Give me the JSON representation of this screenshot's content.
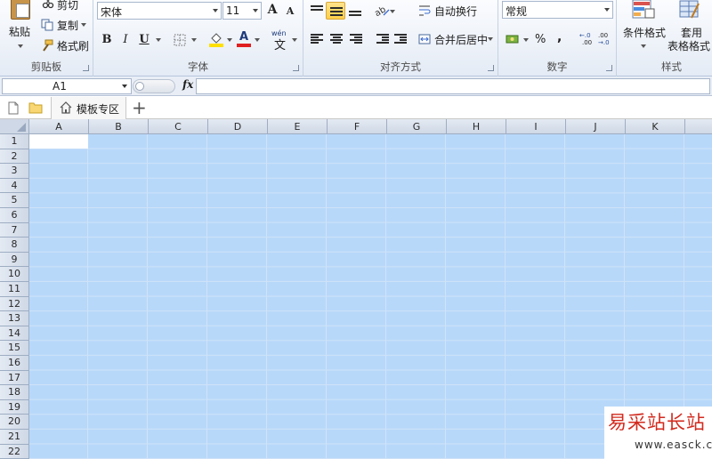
{
  "clipboard": {
    "paste_label": "粘贴",
    "cut_label": "剪切",
    "copy_label": "复制",
    "format_painter_label": "格式刷",
    "group_label": "剪贴板"
  },
  "font": {
    "name": "宋体",
    "size": "11",
    "bold": "B",
    "italic": "I",
    "underline": "U",
    "grow_font": "A",
    "shrink_font": "A",
    "font_color_glyph": "A",
    "phonetic_glyph": "wén",
    "group_label": "字体"
  },
  "alignment": {
    "wrap_text_label": "自动换行",
    "merge_center_label": "合并后居中",
    "group_label": "对齐方式",
    "selected_button": "middle-align"
  },
  "number": {
    "format": "常规",
    "percent": "%",
    "comma": ",",
    "increase_decimal_top": "←.0",
    "increase_decimal_bottom": ".00",
    "decrease_decimal_top": ".00",
    "decrease_decimal_bottom": "→.0",
    "group_label": "数字"
  },
  "styles": {
    "conditional_formatting_label": "条件格式",
    "format_as_table_line1": "套用",
    "format_as_table_line2": "表格格式",
    "group_label": "样式"
  },
  "formula_bar": {
    "name_box": "A1",
    "fx": "fx",
    "formula": ""
  },
  "tabs": {
    "template_tab_label": "模板专区",
    "add_tab": "+"
  },
  "sheet": {
    "columns": [
      "A",
      "B",
      "C",
      "D",
      "E",
      "F",
      "G",
      "H",
      "I",
      "J",
      "K"
    ],
    "rows": [
      "1",
      "2",
      "3",
      "4",
      "5",
      "6",
      "7",
      "8",
      "9",
      "10",
      "11",
      "12",
      "13",
      "14",
      "15",
      "16",
      "17",
      "18",
      "19",
      "20",
      "21",
      "22"
    ],
    "active_cell": "A1",
    "selection_color": "#b8d8fa"
  },
  "watermark": {
    "brand_text": "易采站长站",
    "url": "www.easck.com"
  },
  "colors": {
    "font_color_bar": "#e02020",
    "fill_color_bar": "#ffe000"
  }
}
